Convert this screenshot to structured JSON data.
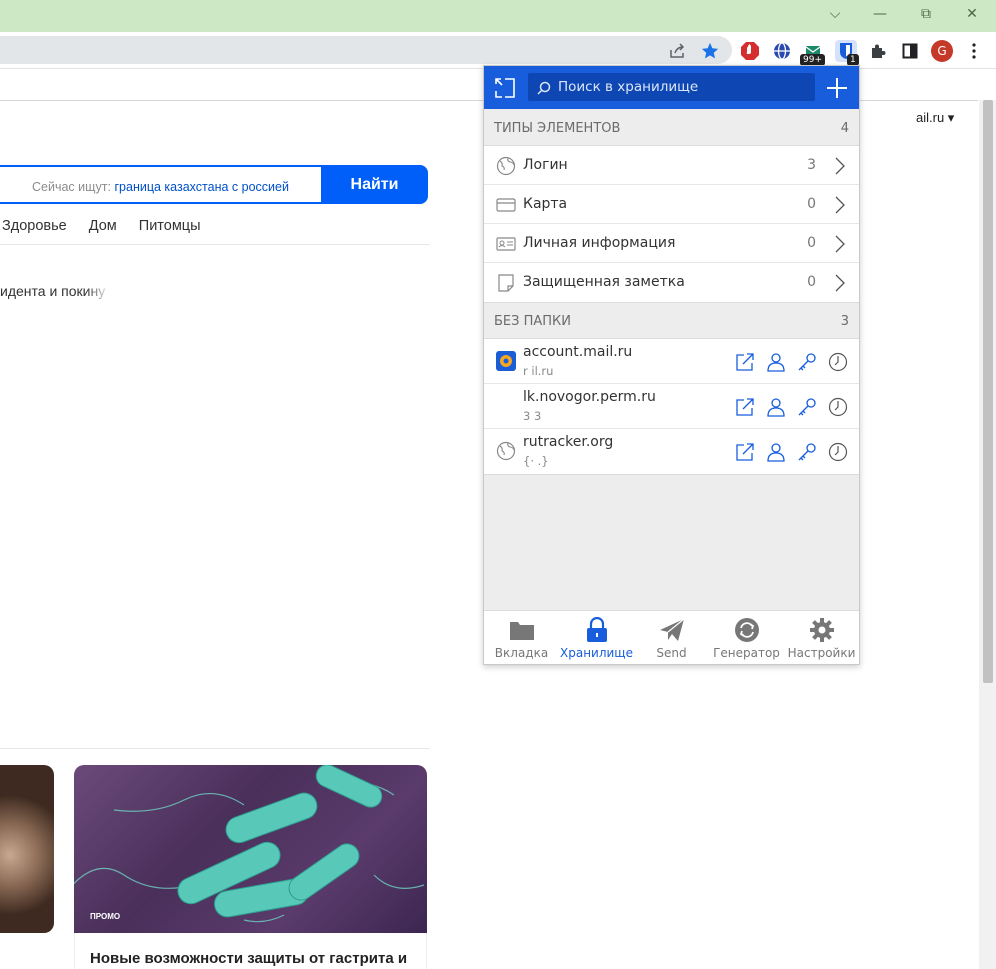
{
  "browser": {
    "window_controls": {
      "chevron": "⌵",
      "minimize": "—",
      "restore": "⧉",
      "close": "✕"
    },
    "extensions": {
      "badge_count": "99+",
      "bitwarden_badge": "1",
      "profile_initial": "G"
    }
  },
  "page": {
    "user_email": "ail.ru ▾",
    "search": {
      "hint_prefix": "Сейчас ищут:",
      "hint_query": "граница казахстана с россией",
      "button": "Найти"
    },
    "categories": [
      "Здоровье",
      "Дом",
      "Питомцы"
    ],
    "news_snippet": "идента и покину",
    "promo_label": "ПРОМО",
    "card_title": "Новые возможности защиты от гастрита и"
  },
  "popup": {
    "search_placeholder": "Поиск в хранилище",
    "types_section": {
      "title": "ТИПЫ ЭЛЕМЕНТОВ",
      "count": "4"
    },
    "types": [
      {
        "icon": "globe-icon",
        "label": "Логин",
        "count": "3"
      },
      {
        "icon": "card-icon",
        "label": "Карта",
        "count": "0"
      },
      {
        "icon": "id-card-icon",
        "label": "Личная информация",
        "count": "0"
      },
      {
        "icon": "note-icon",
        "label": "Защищенная заметка",
        "count": "0"
      }
    ],
    "nofolder_section": {
      "title": "БЕЗ ПАПКИ",
      "count": "3"
    },
    "items": [
      {
        "icon": "mailru-icon",
        "name": "account.mail.ru",
        "sub": "r               il.ru"
      },
      {
        "icon": "",
        "name": "lk.novogor.perm.ru",
        "sub": "3         3"
      },
      {
        "icon": "globe-icon",
        "name": "rutracker.org",
        "sub": "{·           .}"
      }
    ],
    "tabs": [
      {
        "icon": "folder-icon",
        "label": "Вкладка",
        "active": false
      },
      {
        "icon": "lock-icon",
        "label": "Хранилище",
        "active": true
      },
      {
        "icon": "send-icon",
        "label": "Send",
        "active": false
      },
      {
        "icon": "generator-icon",
        "label": "Генератор",
        "active": false
      },
      {
        "icon": "gear-icon",
        "label": "Настройки",
        "active": false
      }
    ],
    "colors": {
      "brand": "#175ddc",
      "active": "#175ddc"
    }
  }
}
